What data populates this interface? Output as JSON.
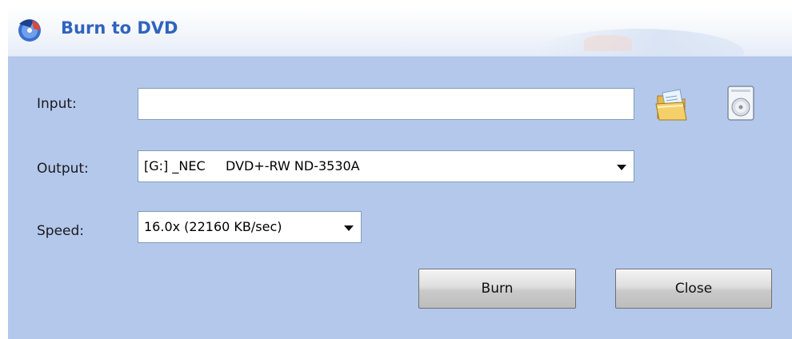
{
  "window": {
    "title": "Burn to DVD"
  },
  "form": {
    "input_label": "Input:",
    "input_value": "",
    "output_label": "Output:",
    "output_value": "[G:] _NEC     DVD+-RW ND-3530A",
    "speed_label": "Speed:",
    "speed_value": "16.0x (22160 KB/sec)"
  },
  "buttons": {
    "burn": "Burn",
    "close": "Close"
  },
  "icons": {
    "app": "dvd-burn-app-icon",
    "browse": "open-folder-icon",
    "image": "disc-image-icon"
  },
  "colors": {
    "panel": "#b4c8ec",
    "title_text": "#2f63c0",
    "field_border": "#7f9db9"
  }
}
